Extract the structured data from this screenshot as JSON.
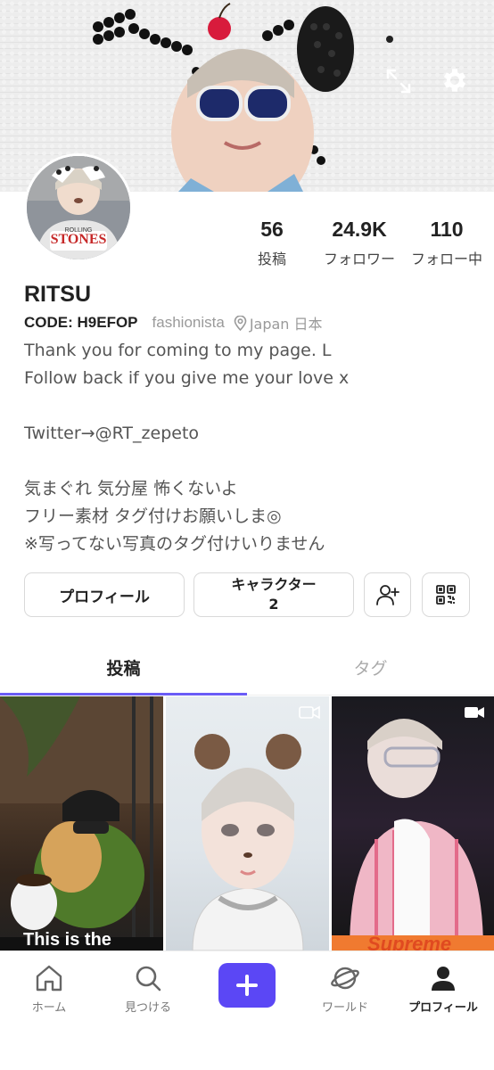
{
  "banner": {
    "expand_icon": "expand-icon",
    "settings_icon": "gear-icon"
  },
  "profile": {
    "username": "RITSU",
    "code": "CODE: H9EFOP",
    "category": "fashionista",
    "location": "Japan 日本",
    "bio_lines": [
      "Thank you for coming to my page. L",
      "Follow back if you give me your love x",
      "",
      "Twitter→@RT_zepeto",
      "",
      "気まぐれ 気分屋 怖くないよ",
      "フリー素材 タグ付けお願いしま◎",
      "※写ってない写真のタグ付けいりません"
    ]
  },
  "stats": {
    "posts": {
      "value": "56",
      "label": "投稿"
    },
    "followers": {
      "value": "24.9K",
      "label": "フォロワー"
    },
    "following": {
      "value": "110",
      "label": "フォロー中"
    }
  },
  "buttons": {
    "profile_label": "プロフィール",
    "character_label": "キャラクター",
    "character_count": "2",
    "add_user_icon": "add-user-icon",
    "qr_icon": "qr-code-icon"
  },
  "tabs": {
    "posts": "投稿",
    "tags": "タグ",
    "active": "posts"
  },
  "posts": [
    {
      "caption": "This is the",
      "video": false
    },
    {
      "caption": "",
      "video": true
    },
    {
      "caption": "Supreme",
      "video": true
    }
  ],
  "nav": {
    "home": "ホーム",
    "discover": "見つける",
    "create_icon": "plus-icon",
    "world": "ワールド",
    "profile": "プロフィール",
    "accent": "#5b47f5"
  },
  "colors": {
    "tab_underline": "#6a5cf6",
    "create_button": "#5b47f5"
  }
}
